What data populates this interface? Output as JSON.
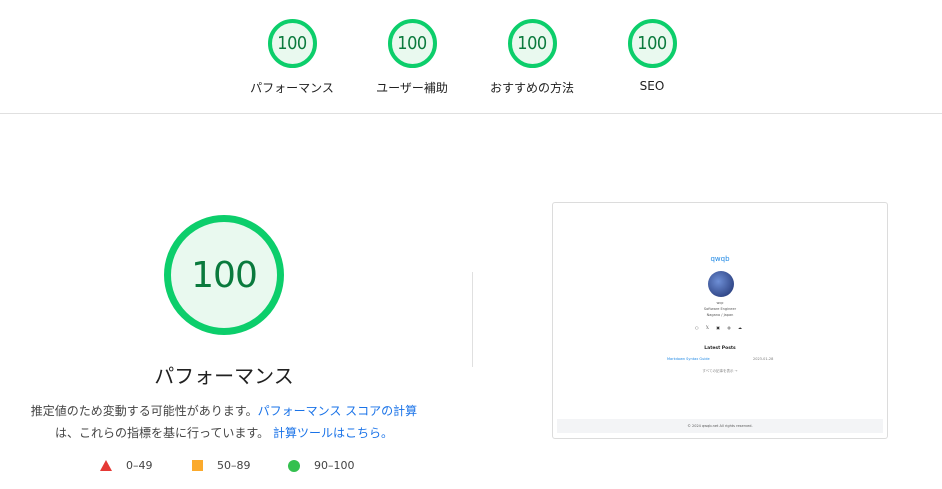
{
  "gauges": [
    {
      "score": "100",
      "label": "パフォーマンス"
    },
    {
      "score": "100",
      "label": "ユーザー補助"
    },
    {
      "score": "100",
      "label": "おすすめの方法"
    },
    {
      "score": "100",
      "label": "SEO"
    }
  ],
  "main": {
    "score": "100",
    "title": "パフォーマンス",
    "desc_text": "推定値のため変動する可能性があります。",
    "desc_link1": "パフォーマンス スコアの計算",
    "desc_text2": "は、これらの指標を基に行っています。",
    "desc_link2": "計算ツールはこちら。"
  },
  "legend": {
    "fail": "0–49",
    "average": "50–89",
    "pass": "90–100"
  },
  "colors": {
    "pass": "#0cce6b",
    "average": "#fbaa2c",
    "fail": "#e53935",
    "link": "#1a73e8"
  },
  "thumbnail": {
    "site_logo": "qwqb",
    "name": "wqc",
    "role": "Software Engineer",
    "location": "Nagano / Japan",
    "icons": "○ 𝕏 ▣ ◍ ☁",
    "latest_title": "Latest Posts",
    "post_title": "Markdown Syntax Guide",
    "post_date": "2023-01-28",
    "more": "すべての記事を表示 →",
    "footer": "© 2024 qwqb.net All rights reserved."
  }
}
